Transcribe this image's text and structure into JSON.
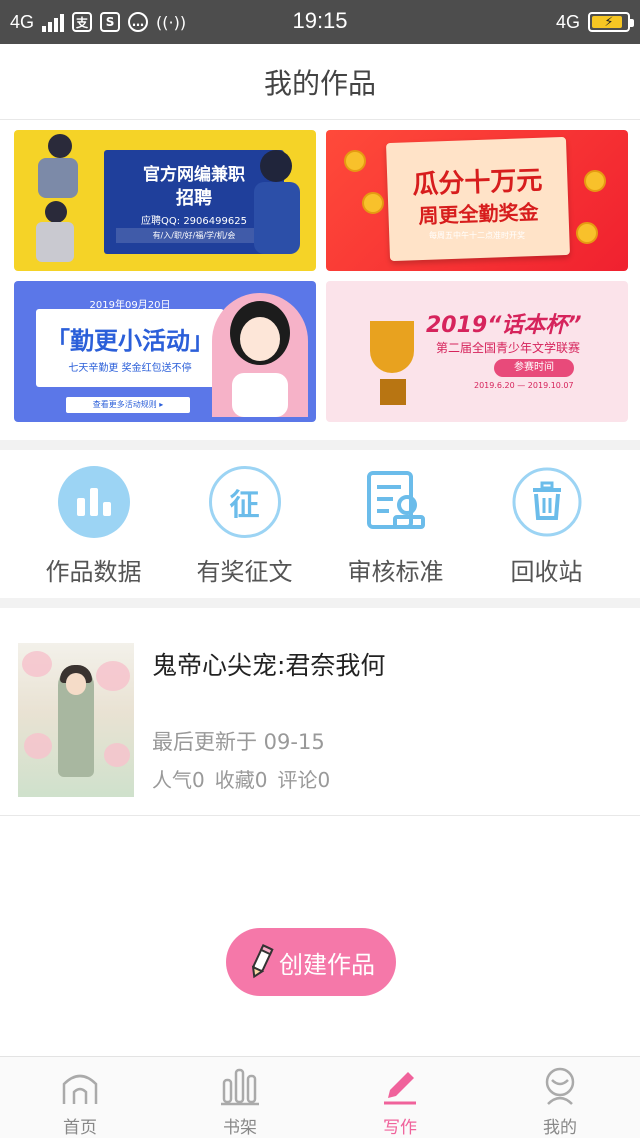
{
  "status_bar": {
    "network_left": "4G",
    "time": "19:15",
    "network_right": "4G",
    "icons": [
      "signal-icon",
      "alipay-icon",
      "app-s-icon",
      "message-icon",
      "hotspot-icon",
      "battery-icon"
    ]
  },
  "header": {
    "title": "我的作品"
  },
  "banners": [
    {
      "name": "recruit",
      "title_line1": "官方网编兼职",
      "title_line2": "招聘",
      "qq": "应聘QQ: 2906499625",
      "tags": "有/入/职/好/福/学/机/会"
    },
    {
      "name": "bonus",
      "title_line1": "瓜分十万元",
      "title_line2": "周更全勤奖金",
      "subtitle": "每周五中午十二点准时开奖"
    },
    {
      "name": "activity",
      "date": "2019年09月20日",
      "title": "「勤更小活动」",
      "slogan": "七天辛勤更 奖金红包送不停",
      "more": "查看更多活动规则 ▸"
    },
    {
      "name": "contest",
      "title": "2019“话本杯”",
      "subtitle": "第二届全国青少年文学联赛",
      "tag": "参赛时间",
      "dates": "2019.6.20 — 2019.10.07"
    }
  ],
  "shortcuts": [
    {
      "label": "作品数据",
      "icon": "bar-chart-icon"
    },
    {
      "label": "有奖征文",
      "icon": "zheng-badge-icon"
    },
    {
      "label": "审核标准",
      "icon": "review-document-icon"
    },
    {
      "label": "回收站",
      "icon": "trash-icon"
    }
  ],
  "work": {
    "title": "鬼帝心尖宠:君奈我何",
    "last_update": "最后更新于 09-15",
    "popularity": "人气0",
    "favorites": "收藏0",
    "comments": "评论0"
  },
  "create_button": {
    "label": "创建作品"
  },
  "tabbar": {
    "active": "写作",
    "tabs": [
      {
        "label": "首页",
        "icon": "home-icon"
      },
      {
        "label": "书架",
        "icon": "bookshelf-icon"
      },
      {
        "label": "写作",
        "icon": "pencil-icon"
      },
      {
        "label": "我的",
        "icon": "profile-icon"
      }
    ]
  },
  "colors": {
    "accent_pink": "#f0629b",
    "create_button": "#f578a9",
    "icon_blue": "#9cd4f4",
    "status_bar": "#4d4d4d"
  }
}
